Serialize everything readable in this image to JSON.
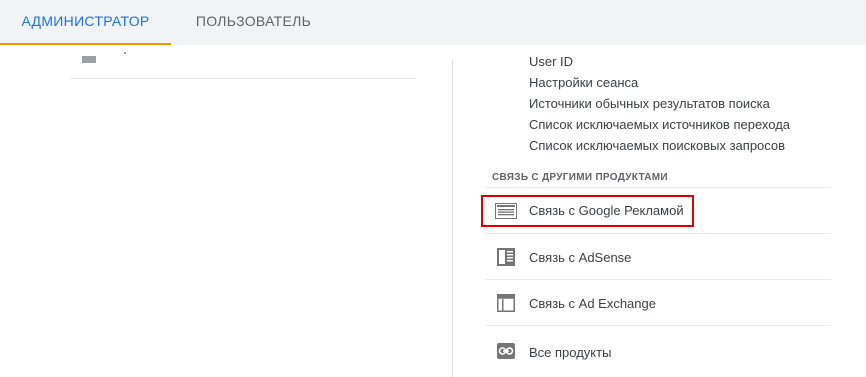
{
  "tabs": {
    "admin_label": "АДМИНИСТРАТОР",
    "user_label": "ПОЛЬЗОВАТЕЛЬ"
  },
  "settings_links": [
    "User ID",
    "Настройки сеанса",
    "Источники обычных результатов поиска",
    "Список исключаемых источников перехода",
    "Список исключаемых поисковых запросов"
  ],
  "product_linking": {
    "section_title": "СВЯЗЬ С ДРУГИМИ ПРОДУКТАМИ",
    "items": [
      {
        "label": "Связь с Google Рекламой",
        "icon": "google-ads-icon",
        "highlighted": true
      },
      {
        "label": "Связь с AdSense",
        "icon": "adsense-icon"
      },
      {
        "label": "Связь с Ad Exchange",
        "icon": "ad-exchange-icon"
      },
      {
        "label": "Все продукты",
        "icon": "link-icon"
      }
    ]
  },
  "colors": {
    "accent": "#1a73e8",
    "tab_underline": "#f29900",
    "highlight_border": "#e00000"
  }
}
